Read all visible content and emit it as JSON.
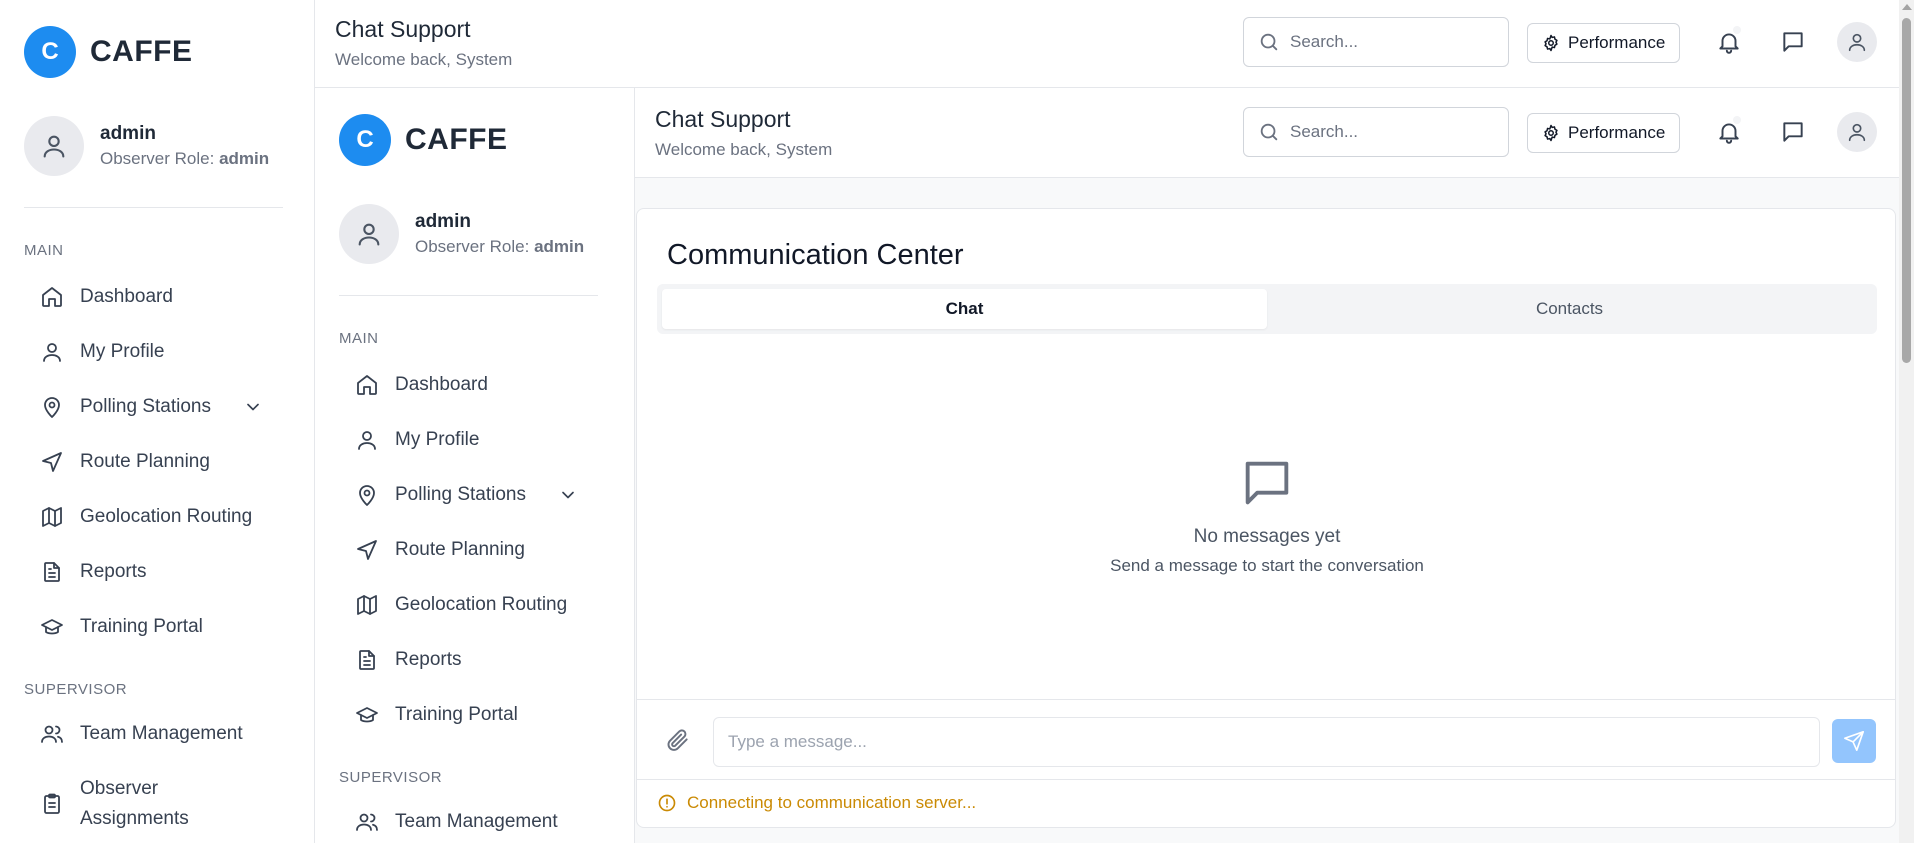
{
  "brand": {
    "logo_letter": "C",
    "name": "CAFFE",
    "color": "#1d8cf0"
  },
  "user": {
    "name": "admin",
    "role_label": "Observer Role:",
    "role_value": "admin"
  },
  "sidebar": {
    "section_main": "MAIN",
    "section_supervisor": "SUPERVISOR",
    "items": [
      {
        "label": "Dashboard",
        "icon": "home-icon"
      },
      {
        "label": "My Profile",
        "icon": "user-icon"
      },
      {
        "label": "Polling Stations",
        "icon": "map-pin-icon"
      },
      {
        "label": "Route Planning",
        "icon": "navigation-icon"
      },
      {
        "label": "Geolocation Routing",
        "icon": "map-icon"
      },
      {
        "label": "Reports",
        "icon": "file-text-icon"
      },
      {
        "label": "Training Portal",
        "icon": "graduation-cap-icon"
      }
    ],
    "supervisor_items": [
      {
        "label": "Team Management",
        "icon": "users-icon"
      },
      {
        "label": "Observer Assignments",
        "icon": "clipboard-icon"
      }
    ]
  },
  "header": {
    "title": "Chat Support",
    "subtitle": "Welcome back, System",
    "search_placeholder": "Search...",
    "performance_label": "Performance"
  },
  "main": {
    "card_title": "Communication Center",
    "tabs": [
      {
        "label": "Chat",
        "active": true
      },
      {
        "label": "Contacts",
        "active": false
      }
    ],
    "empty_title": "No messages yet",
    "empty_subtitle": "Send a message to start the conversation",
    "message_placeholder": "Type a message...",
    "status_text": "Connecting to communication server...",
    "status_color": "#ca8a04",
    "send_color": "#93c5fd"
  }
}
